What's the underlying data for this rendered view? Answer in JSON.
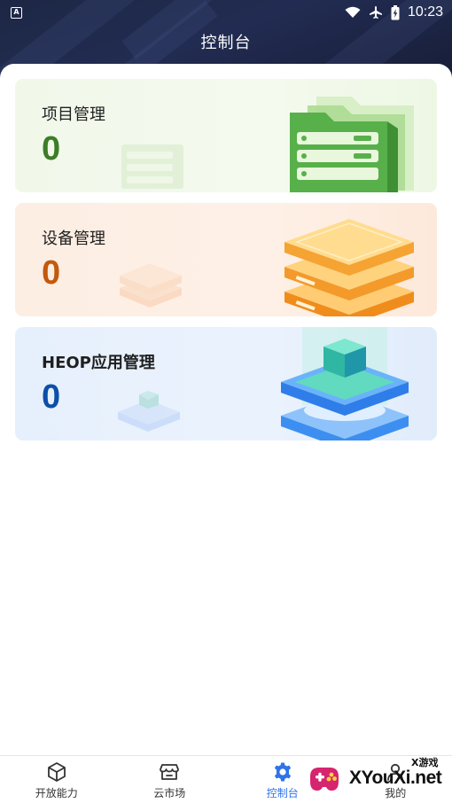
{
  "status_bar": {
    "notification_icon": "a-letter-icon",
    "icons": [
      "wifi-icon",
      "airplane-icon",
      "battery-charging-icon"
    ],
    "time": "10:23"
  },
  "header": {
    "title": "控制台"
  },
  "cards": {
    "project": {
      "label": "项目管理",
      "count": "0",
      "accent": "#3c7d26",
      "icon": "folder-illustration"
    },
    "device": {
      "label": "设备管理",
      "count": "0",
      "accent": "#c25a0c",
      "icon": "server-stack-illustration"
    },
    "heop": {
      "label": "HEOP应用管理",
      "count": "0",
      "accent": "#0b4fa8",
      "icon": "cube-platform-illustration"
    }
  },
  "bottom_nav": {
    "active_color": "#2f73e8",
    "items": [
      {
        "label": "开放能力",
        "icon": "cube-icon"
      },
      {
        "label": "云市场",
        "icon": "store-icon"
      },
      {
        "label": "控制台",
        "icon": "gear-icon"
      },
      {
        "label": "我的",
        "icon": "user-icon"
      }
    ]
  },
  "watermark": {
    "text": "XYouXi.net",
    "small_text": "X游戏"
  }
}
